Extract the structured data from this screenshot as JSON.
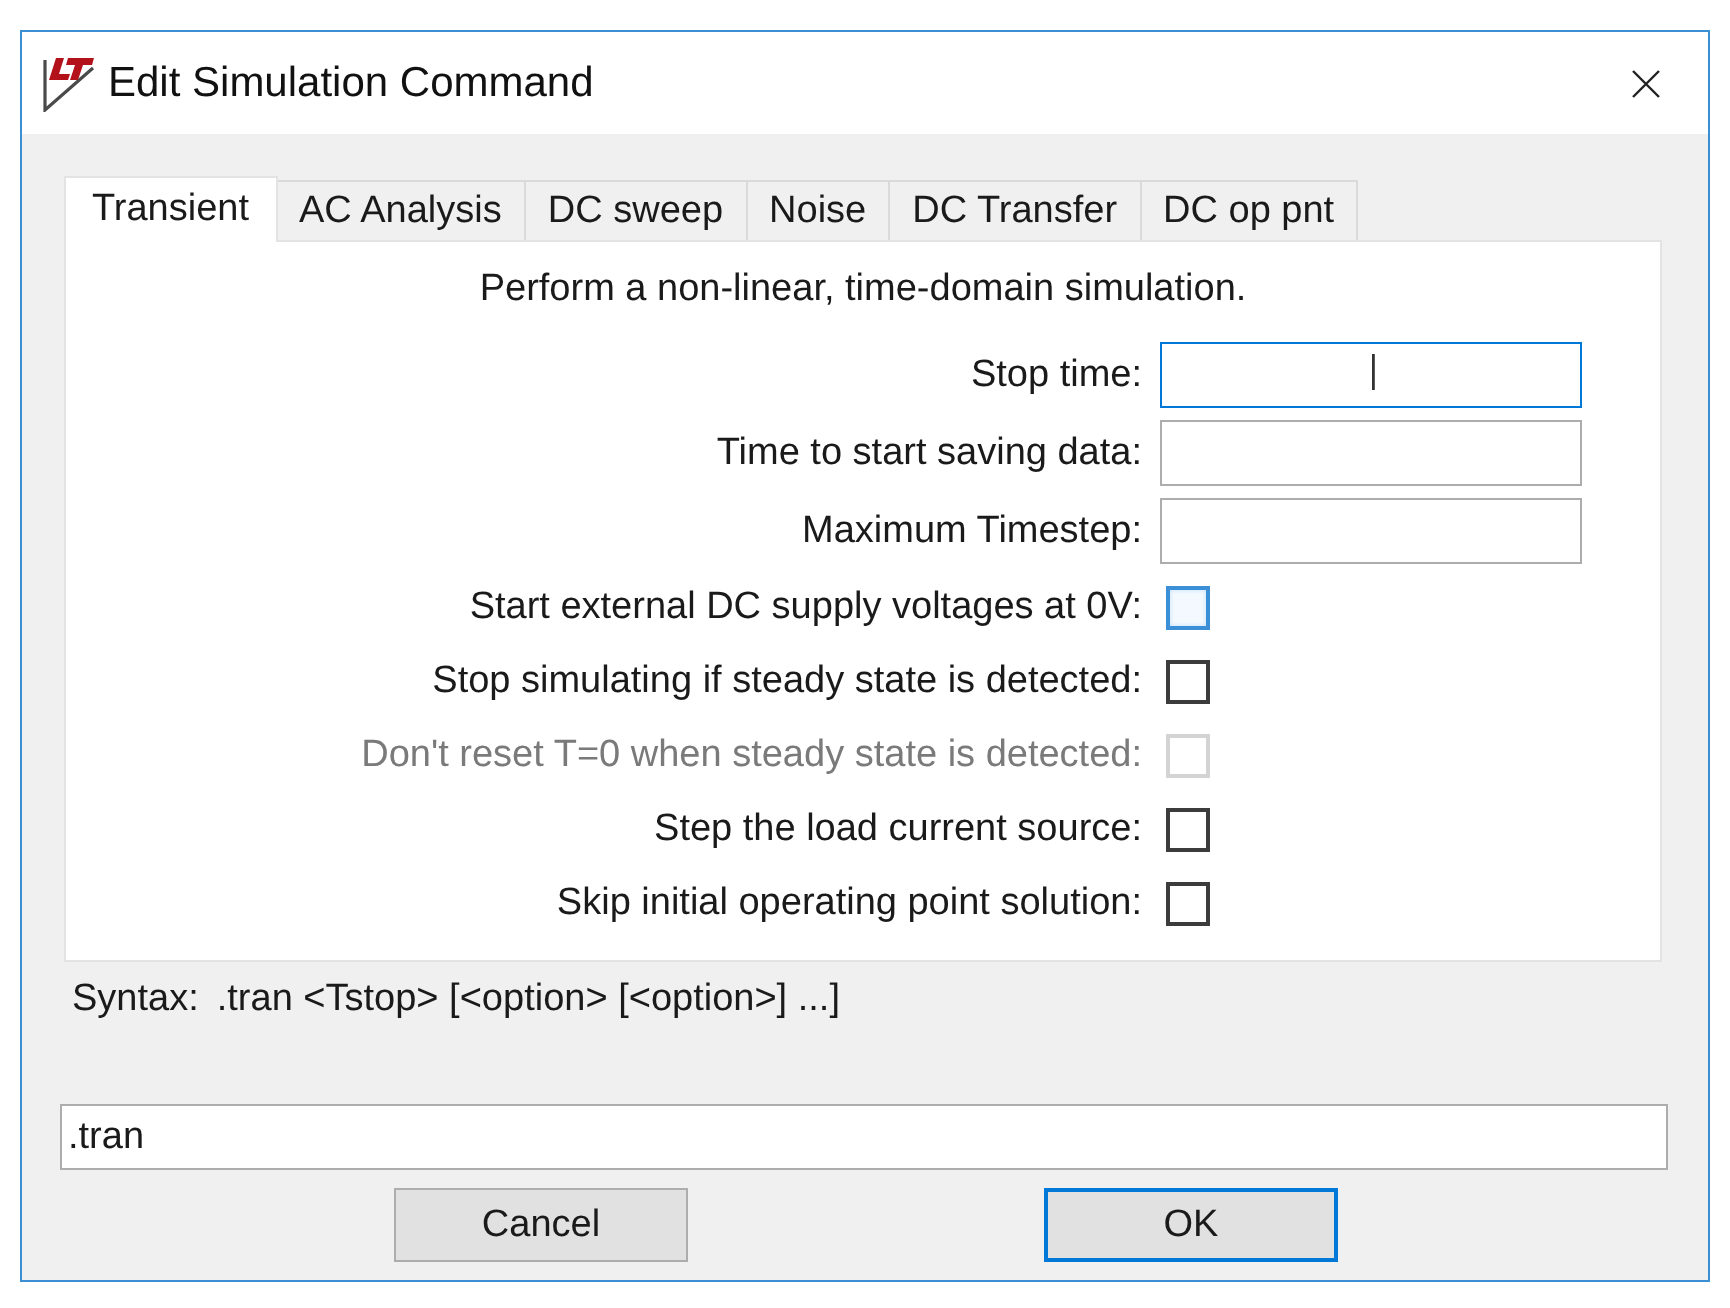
{
  "window": {
    "title": "Edit Simulation Command"
  },
  "tabs": [
    {
      "label": "Transient",
      "selected": true
    },
    {
      "label": "AC Analysis",
      "selected": false
    },
    {
      "label": "DC sweep",
      "selected": false
    },
    {
      "label": "Noise",
      "selected": false
    },
    {
      "label": "DC Transfer",
      "selected": false
    },
    {
      "label": "DC op pnt",
      "selected": false
    }
  ],
  "panel": {
    "description": "Perform a non-linear, time-domain simulation.",
    "fields": [
      {
        "label": "Stop time:",
        "focused": true
      },
      {
        "label": "Time to start saving data:",
        "focused": false
      },
      {
        "label": "Maximum Timestep:",
        "focused": false
      }
    ],
    "options": [
      {
        "label": "Start external DC supply voltages at 0V:",
        "checked": false,
        "disabled": false,
        "highlighted": true
      },
      {
        "label": "Stop simulating if steady state is detected:",
        "checked": false,
        "disabled": false,
        "highlighted": false
      },
      {
        "label": "Don't reset T=0 when steady state is detected:",
        "checked": false,
        "disabled": true,
        "highlighted": false
      },
      {
        "label": "Step the load current source:",
        "checked": false,
        "disabled": false,
        "highlighted": false
      },
      {
        "label": "Skip initial operating point solution:",
        "checked": false,
        "disabled": false,
        "highlighted": false
      }
    ]
  },
  "syntax": {
    "label": "Syntax:",
    "text": ".tran <Tstop> [<option> [<option>] ...]"
  },
  "command": {
    "value": ".tran"
  },
  "buttons": [
    {
      "label": "Cancel",
      "default": false
    },
    {
      "label": "OK",
      "default": true
    }
  ]
}
